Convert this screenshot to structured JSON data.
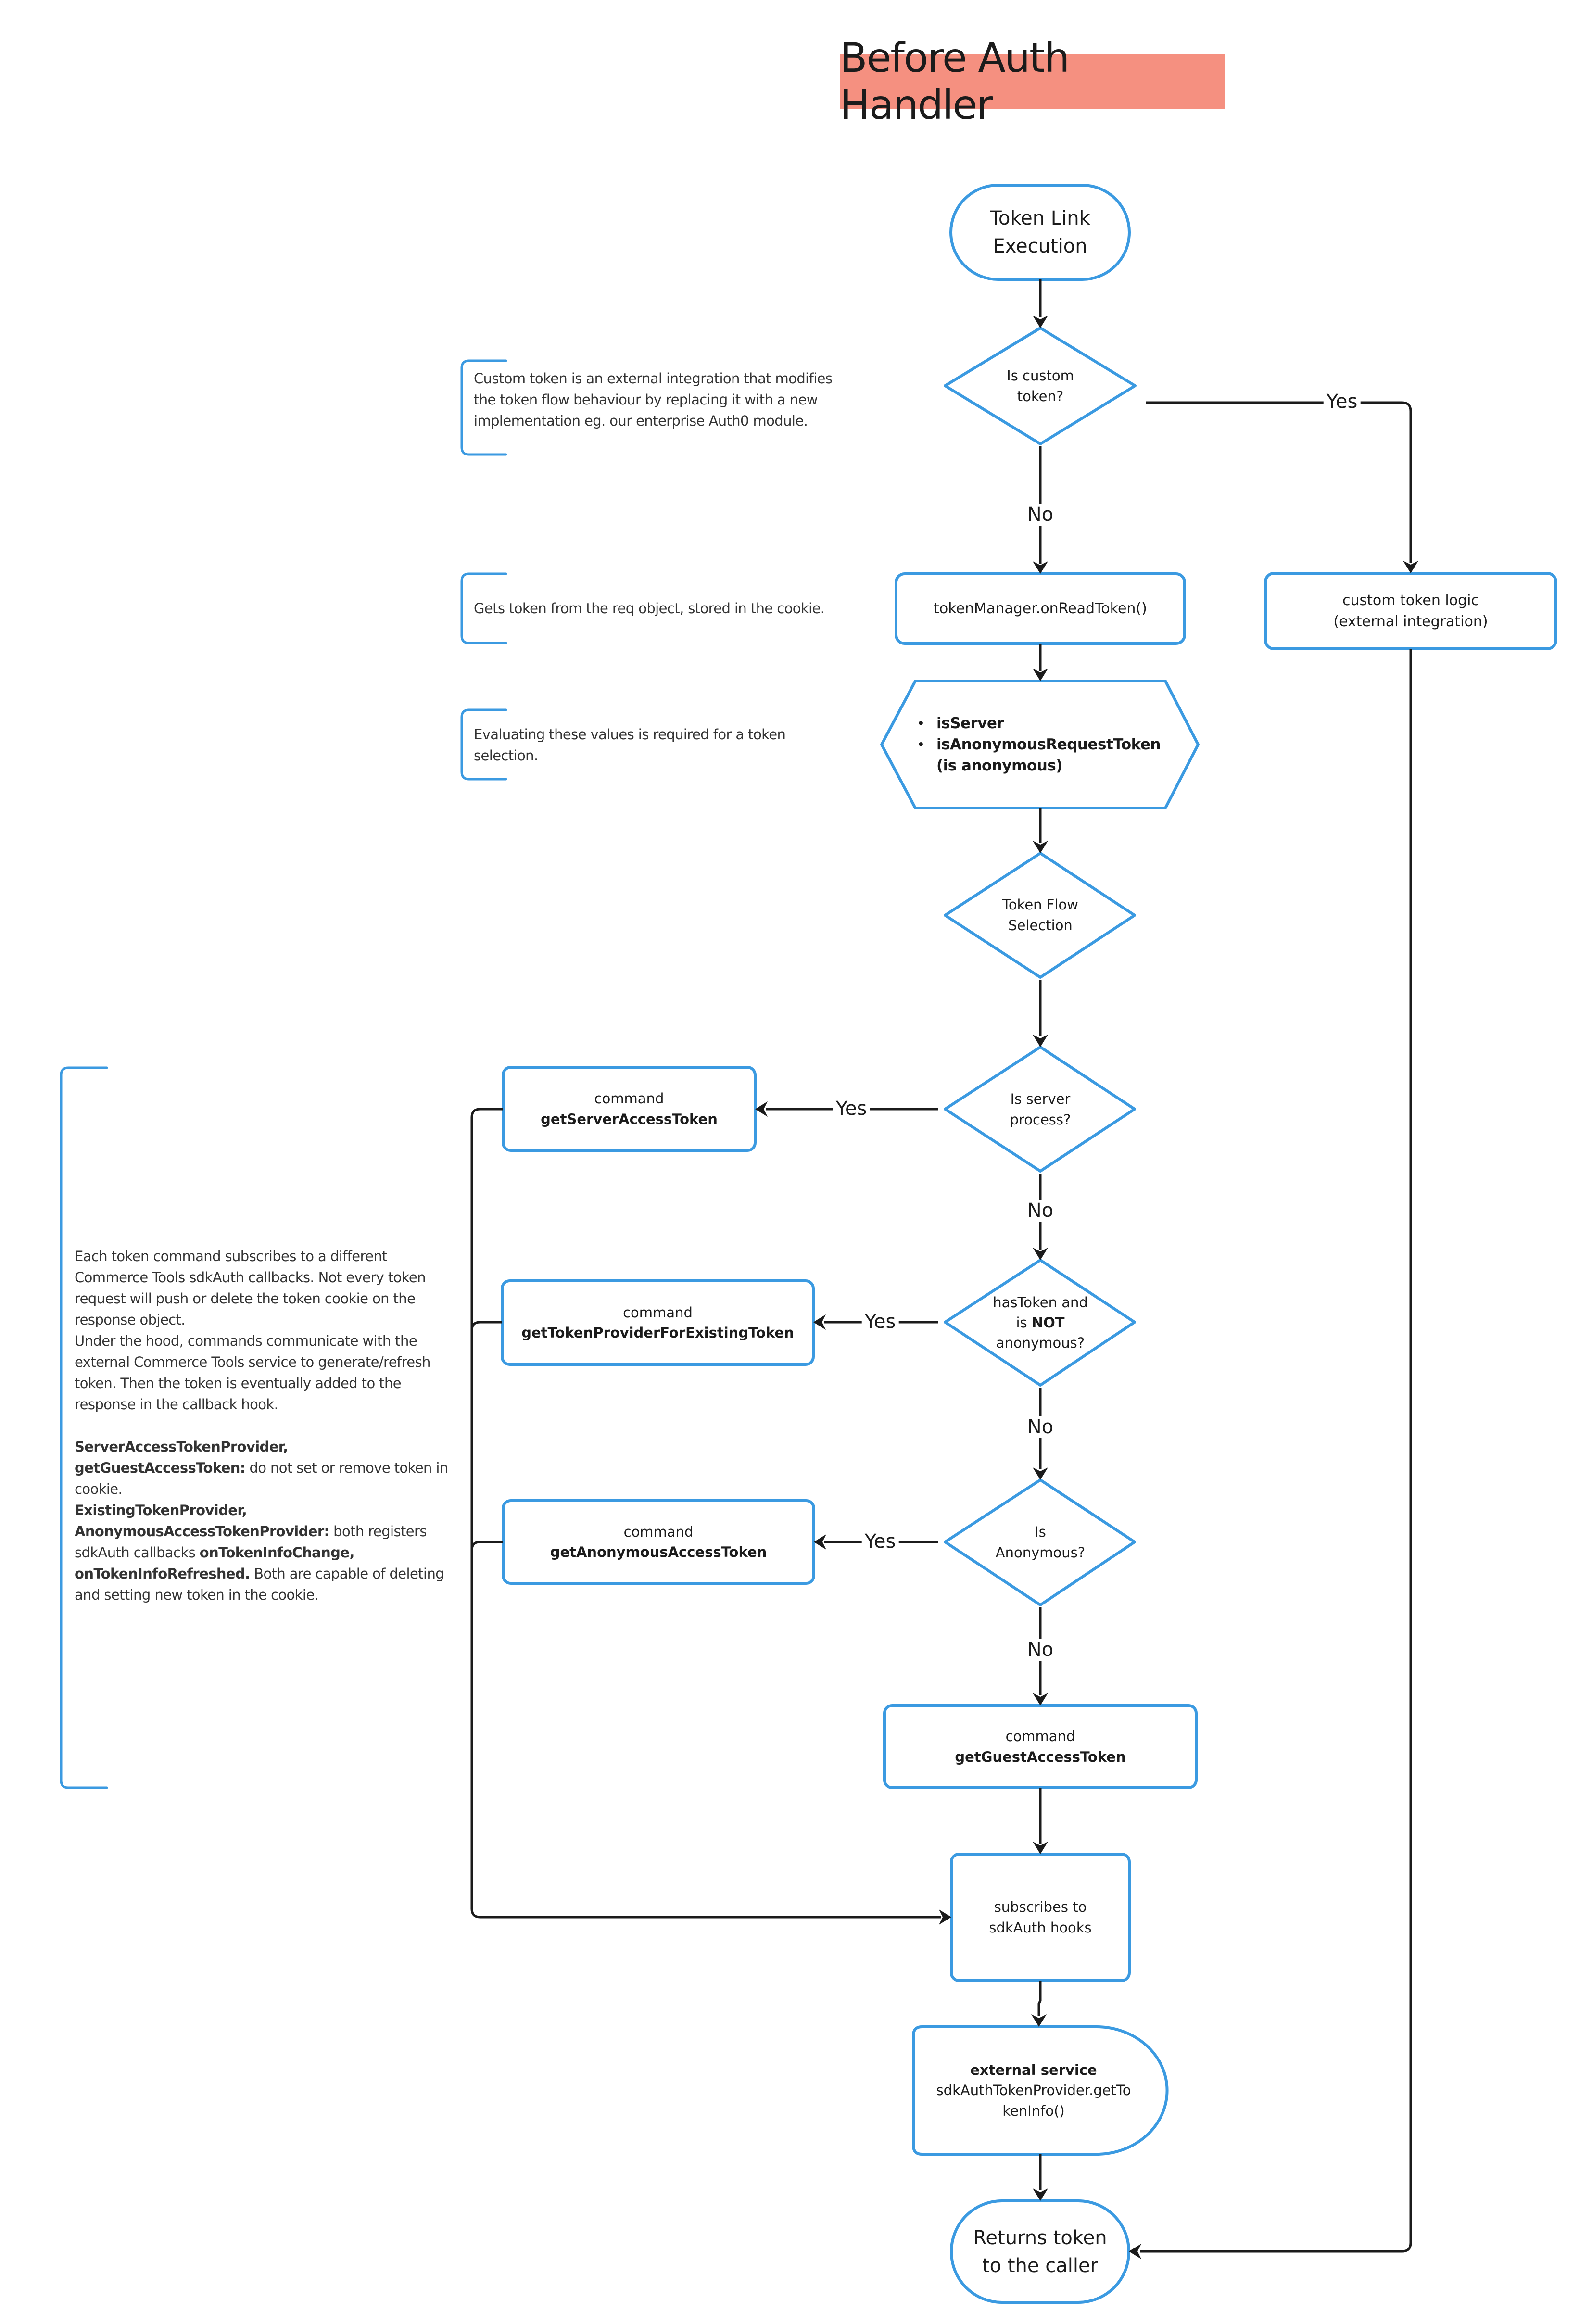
{
  "title": "Before Auth Handler",
  "colors": {
    "title_bg": "#f59080",
    "shape_stroke": "#3b9ae1",
    "connector": "#1b1b1b",
    "note_bracket": "#3b9ae1"
  },
  "nodes": {
    "start": {
      "type": "terminator",
      "lines": [
        "Token Link",
        "Execution"
      ]
    },
    "is_custom_token": {
      "type": "decision",
      "lines": [
        "Is custom",
        "token?"
      ]
    },
    "token_manager": {
      "type": "process",
      "lines": [
        "tokenManager.onReadToken()"
      ]
    },
    "custom_token_logic": {
      "type": "process",
      "lines": [
        "custom token logic",
        "(external integration)"
      ]
    },
    "evaluate_values": {
      "type": "preparation",
      "items": [
        "isServer",
        "isAnonymousRequestToken",
        "(is anonymous)"
      ]
    },
    "token_flow_selection": {
      "type": "decision",
      "lines": [
        "Token Flow",
        "Selection"
      ]
    },
    "is_server_process": {
      "type": "decision",
      "lines": [
        "Is server",
        "process?"
      ]
    },
    "get_server_access_token": {
      "type": "process",
      "prefix": "command",
      "name": "getServerAccessToken"
    },
    "has_token_not_anonymous": {
      "type": "decision",
      "line1": "hasToken and",
      "line2_prefix": "is ",
      "line2_bold": "NOT",
      "line3": "anonymous?"
    },
    "get_token_provider_existing": {
      "type": "process",
      "prefix": "command",
      "name": "getTokenProviderForExistingToken"
    },
    "is_anonymous": {
      "type": "decision",
      "lines": [
        "Is",
        "Anonymous?"
      ]
    },
    "get_anonymous_access_token": {
      "type": "process",
      "prefix": "command",
      "name": "getAnonymousAccessToken"
    },
    "get_guest_access_token": {
      "type": "process",
      "prefix": "command",
      "name": "getGuestAccessToken"
    },
    "subscribes_hooks": {
      "type": "process",
      "lines": [
        "subscribes to",
        "sdkAuth hooks"
      ]
    },
    "external_service": {
      "type": "delay",
      "heading": "external service",
      "lines": [
        "sdkAuthTokenProvider.getTo",
        "kenInfo()"
      ]
    },
    "returns_token": {
      "type": "terminator",
      "lines": [
        "Returns token",
        "to the caller"
      ]
    }
  },
  "edge_labels": {
    "custom_yes": "Yes",
    "custom_no": "No",
    "server_yes": "Yes",
    "server_no": "No",
    "existing_yes": "Yes",
    "existing_no": "No",
    "anonymous_yes": "Yes",
    "anonymous_no": "No"
  },
  "notes": {
    "custom_token": "Custom token is an external integration that modifies the token flow behaviour by replacing it with a new implementation eg. our enterprise Auth0 module.",
    "token_manager": "Gets token from the req object, stored in the cookie.",
    "evaluate": "Evaluating these values is required for a token selection.",
    "commands": {
      "para1": "Each token command subscribes to a different Commerce Tools sdkAuth callbacks. Not every token request will push or delete the token cookie on the response object.",
      "para2": "Under the hood, commands communicate with the external Commerce Tools service to generate/refresh token. Then the token is eventually added to the response in the callback hook.",
      "p3_bold": "ServerAccessTokenProvider, getGuestAccessToken:",
      "p3_text": " do not set or remove token in cookie.",
      "p4_bold": "ExistingTokenProvider, AnonymousAccessTokenProvider:",
      "p4_text1": " both registers sdkAuth callbacks ",
      "p4_bold2": "onTokenInfoChange, onTokenInfoRefreshed.",
      "p4_text2": " Both are capable of deleting and setting new token in the cookie."
    }
  }
}
